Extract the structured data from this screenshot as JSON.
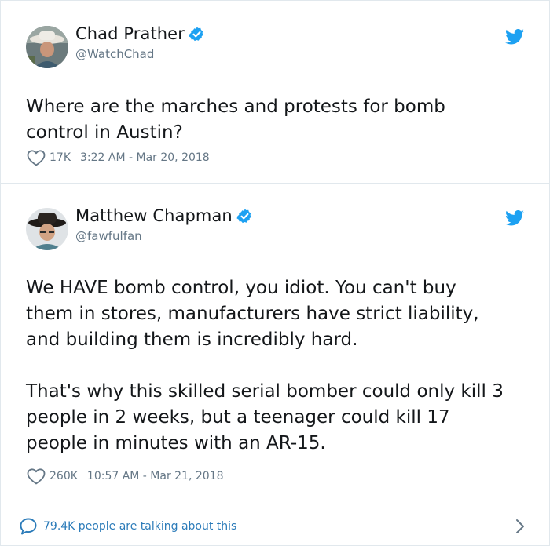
{
  "tweets": [
    {
      "display_name": "Chad Prather",
      "handle": "@WatchChad",
      "text": "Where are the marches and protests for bomb\ncontrol in Austin?",
      "likes": "17K",
      "timestamp": "3:22 AM - Mar 20, 2018",
      "avatar_icon": "cowboy-hat-avatar",
      "verified": true
    },
    {
      "display_name": "Matthew Chapman",
      "handle": "@fawfulfan",
      "text": "We HAVE bomb control, you idiot. You can't buy\nthem in stores, manufacturers have strict liability,\nand building them is incredibly hard.\n\nThat's why this skilled serial bomber could only kill 3\npeople in 2 weeks, but a teenager could kill 17\npeople in minutes with an AR-15.",
      "likes": "260K",
      "timestamp": "10:57 AM - Mar 21, 2018",
      "avatar_icon": "cowboy-hat-avatar",
      "verified": true
    }
  ],
  "footer": {
    "talk_text": "79.4K people are talking about this"
  },
  "colors": {
    "twitter_blue": "#1da1f2",
    "link_blue": "#2b7bb9",
    "text": "#14171a",
    "muted": "#657786",
    "border": "#e1e8ed"
  }
}
